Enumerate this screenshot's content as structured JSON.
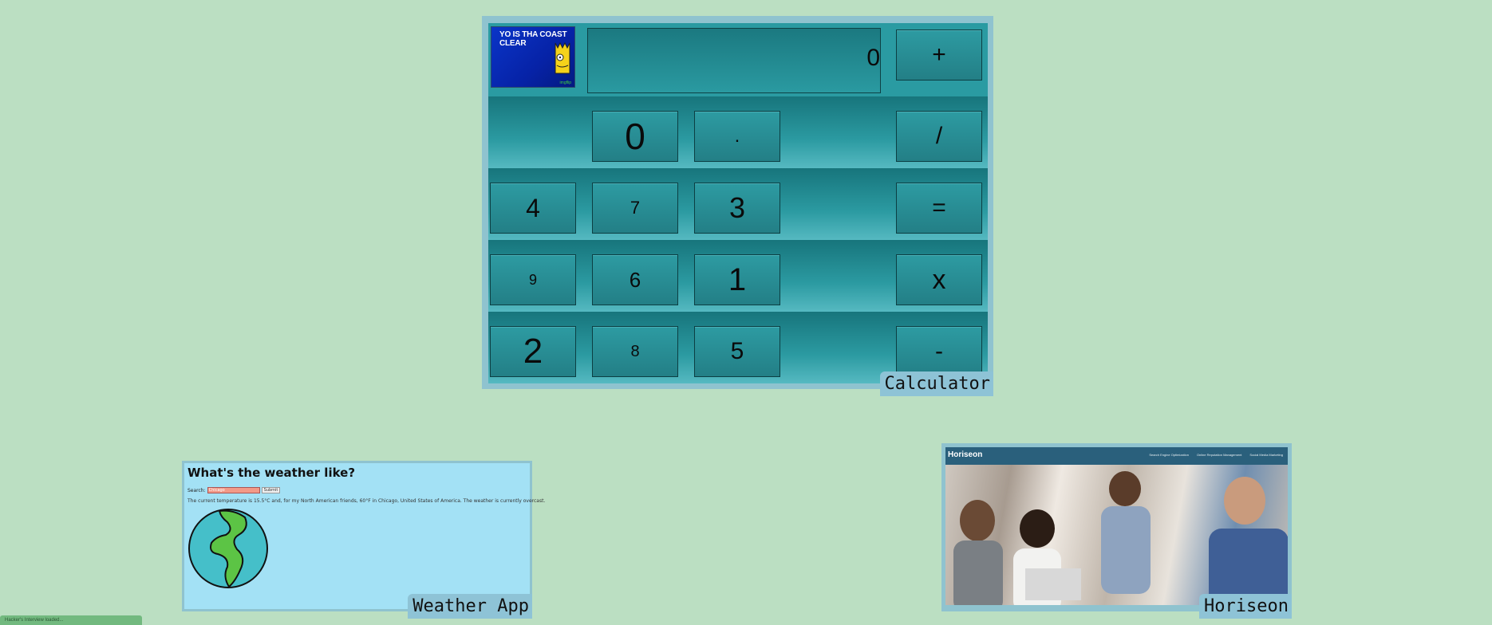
{
  "calculator": {
    "label": "Calculator",
    "thumbnail_caption": "YO IS THA COAST CLEAR",
    "display_value": "0",
    "rows": [
      [
        {
          "key": "0"
        },
        {
          "key": "."
        },
        {
          "key": "/"
        }
      ],
      [
        {
          "key": "4"
        },
        {
          "key": "7"
        },
        {
          "key": "3"
        },
        {
          "key": "="
        }
      ],
      [
        {
          "key": "9"
        },
        {
          "key": "6"
        },
        {
          "key": "1"
        },
        {
          "key": "x"
        }
      ],
      [
        {
          "key": "2"
        },
        {
          "key": "8"
        },
        {
          "key": "5"
        },
        {
          "key": "-"
        }
      ]
    ],
    "plus": "+"
  },
  "weather": {
    "label": "Weather App",
    "title": "What's the weather like?",
    "search_label": "Search:",
    "search_value": "Chicago",
    "search_button": "Submit",
    "description": "The current temperature is 15.5°C and, for my North American friends, 60°F in Chicago, United States of America. The weather is currently overcast."
  },
  "horiseon": {
    "label": "Horiseon",
    "brand": "Horiseon",
    "nav": [
      "Search Engine Optimization",
      "Online Reputation Management",
      "Social Media Marketing"
    ]
  },
  "status": {
    "text": "Hacker's Interview loaded..."
  },
  "colors": {
    "background": "#bbdfc2",
    "calc_teal": "#2a979e",
    "card_border": "#8fc3cf",
    "weather_bg": "#a3e1f5",
    "horiseon_header": "#2a607c"
  }
}
